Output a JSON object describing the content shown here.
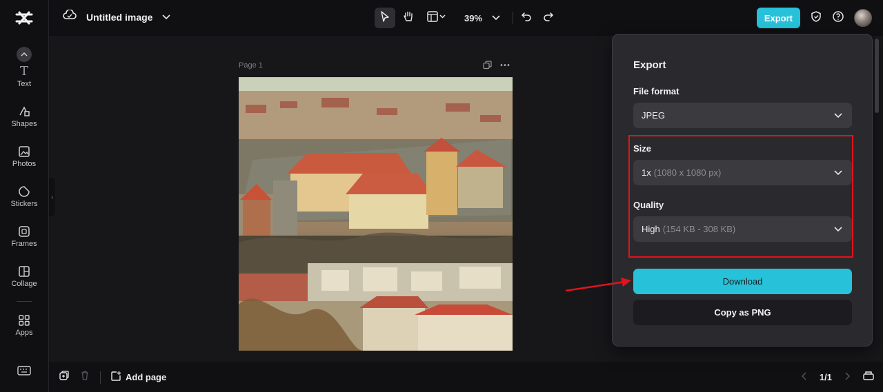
{
  "header": {
    "title": "Untitled image",
    "zoom": "39%",
    "export_label": "Export"
  },
  "sidebar": {
    "items": [
      {
        "label": "Text",
        "icon": "text-icon"
      },
      {
        "label": "Shapes",
        "icon": "shapes-icon"
      },
      {
        "label": "Photos",
        "icon": "photos-icon"
      },
      {
        "label": "Stickers",
        "icon": "stickers-icon"
      },
      {
        "label": "Frames",
        "icon": "frames-icon"
      },
      {
        "label": "Collage",
        "icon": "collage-icon"
      },
      {
        "label": "Apps",
        "icon": "apps-icon"
      }
    ]
  },
  "canvas": {
    "page_label": "Page 1"
  },
  "bottom": {
    "add_page_label": "Add page",
    "page_count": "1/1"
  },
  "export_panel": {
    "title": "Export",
    "file_format_label": "File format",
    "file_format_value": "JPEG",
    "size_label": "Size",
    "size_value": "1x",
    "size_detail": "(1080 x 1080 px)",
    "quality_label": "Quality",
    "quality_value": "High",
    "quality_detail": "(154 KB - 308 KB)",
    "download_label": "Download",
    "copy_label": "Copy as PNG"
  },
  "colors": {
    "accent": "#27c2da",
    "highlight": "#e0141a"
  }
}
